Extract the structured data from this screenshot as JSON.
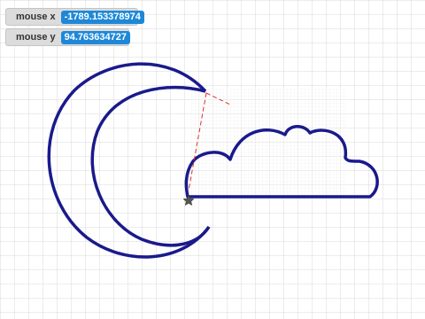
{
  "monitors": {
    "mouse_x": {
      "label": "mouse x",
      "value": "-1789.153378974"
    },
    "mouse_y": {
      "label": "mouse y",
      "value": "94.763634727"
    }
  },
  "colors": {
    "background": "#ffffff",
    "grid": "#d9d9d9",
    "shape_stroke": "#1a1a8c",
    "guide_line": "#e03030",
    "monitor_value_bg": "#1e88d8"
  },
  "icons": {
    "moon": "crescent-moon-outline",
    "cloud": "cloud-outline",
    "cursor": "star-cursor"
  }
}
